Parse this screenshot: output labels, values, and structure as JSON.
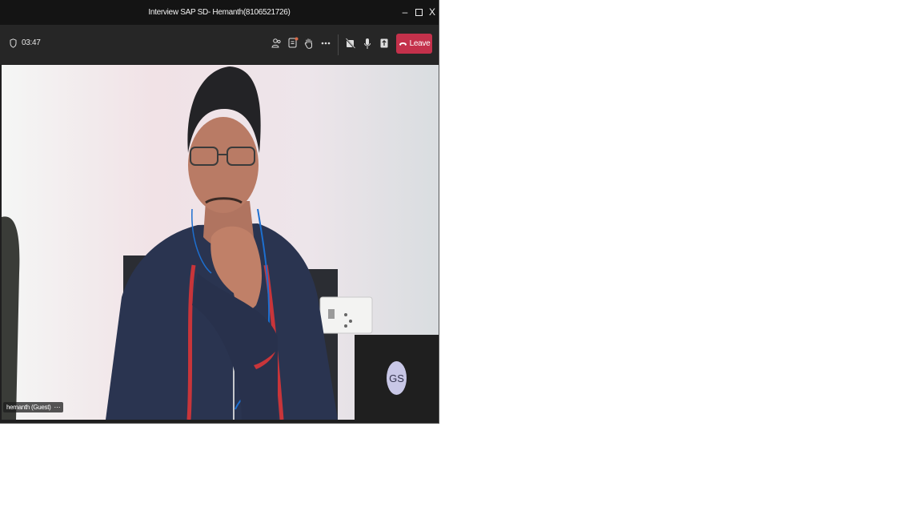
{
  "window": {
    "title": "Interview SAP SD- Hemanth(8106521726)",
    "controls": {
      "minimize": "–",
      "maximize": "☐",
      "close": "X"
    }
  },
  "toolbar": {
    "timer": "03:47",
    "leave_label": "Leave",
    "icons": [
      "shield-icon",
      "people-icon",
      "chat-icon",
      "raise-hand-icon",
      "more-icon",
      "camera-off-icon",
      "mic-icon",
      "share-icon",
      "phone-hangup-icon"
    ],
    "leave_color": "#c4314b"
  },
  "participant": {
    "name": "hemanth (Guest)",
    "more": "⋯"
  },
  "self": {
    "initials": "GS"
  }
}
